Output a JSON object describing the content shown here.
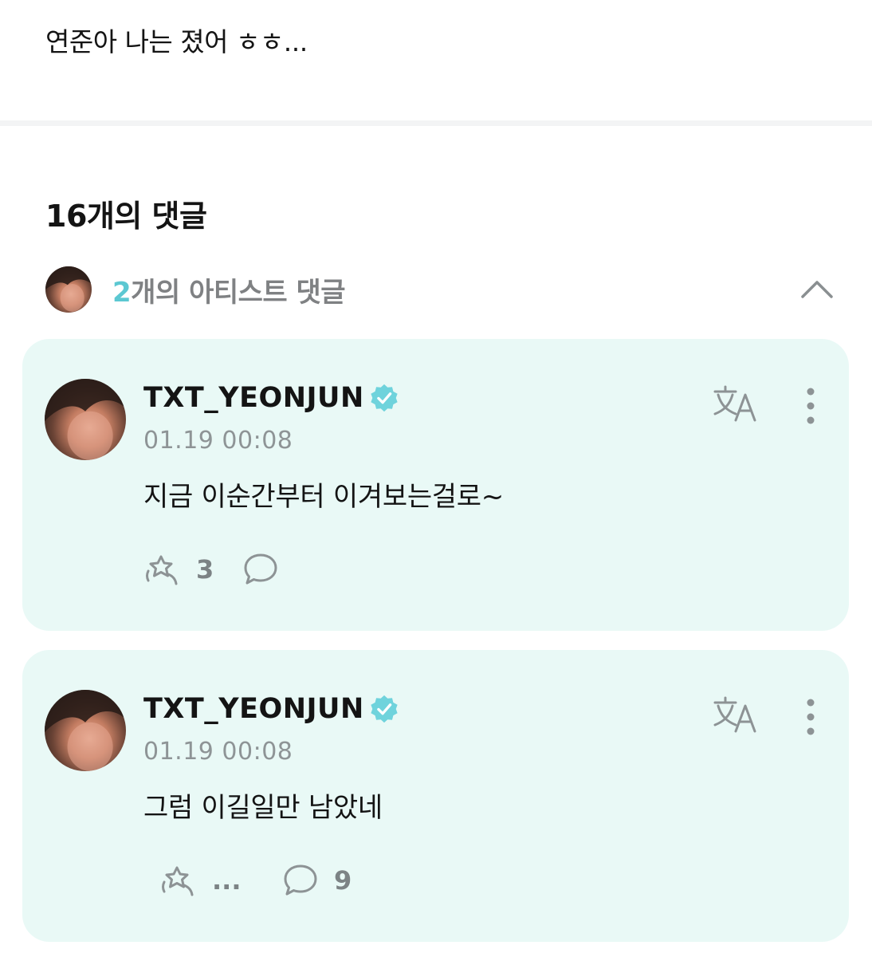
{
  "post": {
    "text": "연준아 나는 졌어 ㅎㅎ..."
  },
  "comments_header": {
    "title": "16개의 댓글"
  },
  "artist_section": {
    "count": "2",
    "label": "개의 아티스트 댓글"
  },
  "comments": [
    {
      "username": "TXT_YEONJUN",
      "timestamp": "01.19 00:08",
      "text": "지금 이순간부터 이겨보는걸로~",
      "like_count": "3",
      "reply_count": ""
    },
    {
      "username": "TXT_YEONJUN",
      "timestamp": "01.19 00:08",
      "text": "그럼 이길일만 남았네",
      "like_count": "...",
      "reply_count": "9"
    }
  ],
  "colors": {
    "accent": "#5cc8d2",
    "card_background": "#e9f9f6",
    "muted_text": "#8e9496"
  },
  "icons": {
    "collapse": "chevron-up-icon",
    "verified": "verified-badge-icon",
    "translate": "translate-icon",
    "more": "more-vertical-icon",
    "like": "star-cheer-icon",
    "reply": "speech-bubble-icon"
  }
}
